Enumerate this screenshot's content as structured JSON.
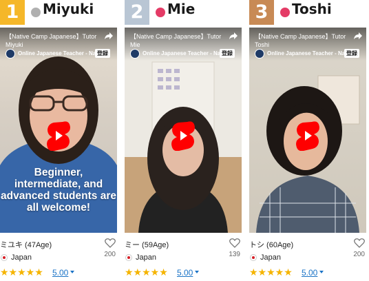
{
  "colors": {
    "gold": "#f5b729",
    "silver": "#b9c6d4",
    "bronze": "#c88a55",
    "pink": "#e43b66",
    "grey_dot": "#b0b0b0",
    "youtube_red": "#ff0000",
    "star": "#f5b400",
    "link": "#1a73c6"
  },
  "video_common": {
    "channel_name": "Online Japanese Teacher - Nati...",
    "subscribe_label": "登録",
    "share_icon": "share-arrow-icon",
    "play_icon": "youtube-shorts-icon"
  },
  "teachers": [
    {
      "rank": "1",
      "name": "Miyuki",
      "video_title": "【Native Camp Japanese】Tutor\nMiyuki",
      "caption": "Beginner, intermediate, and advanced students are all welcome!",
      "display_name": "ミユキ (47Age)",
      "favorites": "200",
      "country": "Japan",
      "stars": "★★★★★",
      "rating": "5.00"
    },
    {
      "rank": "2",
      "name": "Mie",
      "video_title": "【Native Camp Japanese】Tutor\nMie",
      "caption": "",
      "display_name": "ミー (59Age)",
      "favorites": "139",
      "country": "Japan",
      "stars": "★★★★★",
      "rating": "5.00"
    },
    {
      "rank": "3",
      "name": "Toshi",
      "video_title": "【Native Camp Japanese】Tutor\nToshi",
      "caption": "",
      "display_name": "トシ (60Age)",
      "favorites": "200",
      "country": "Japan",
      "stars": "★★★★★",
      "rating": "5.00"
    }
  ]
}
